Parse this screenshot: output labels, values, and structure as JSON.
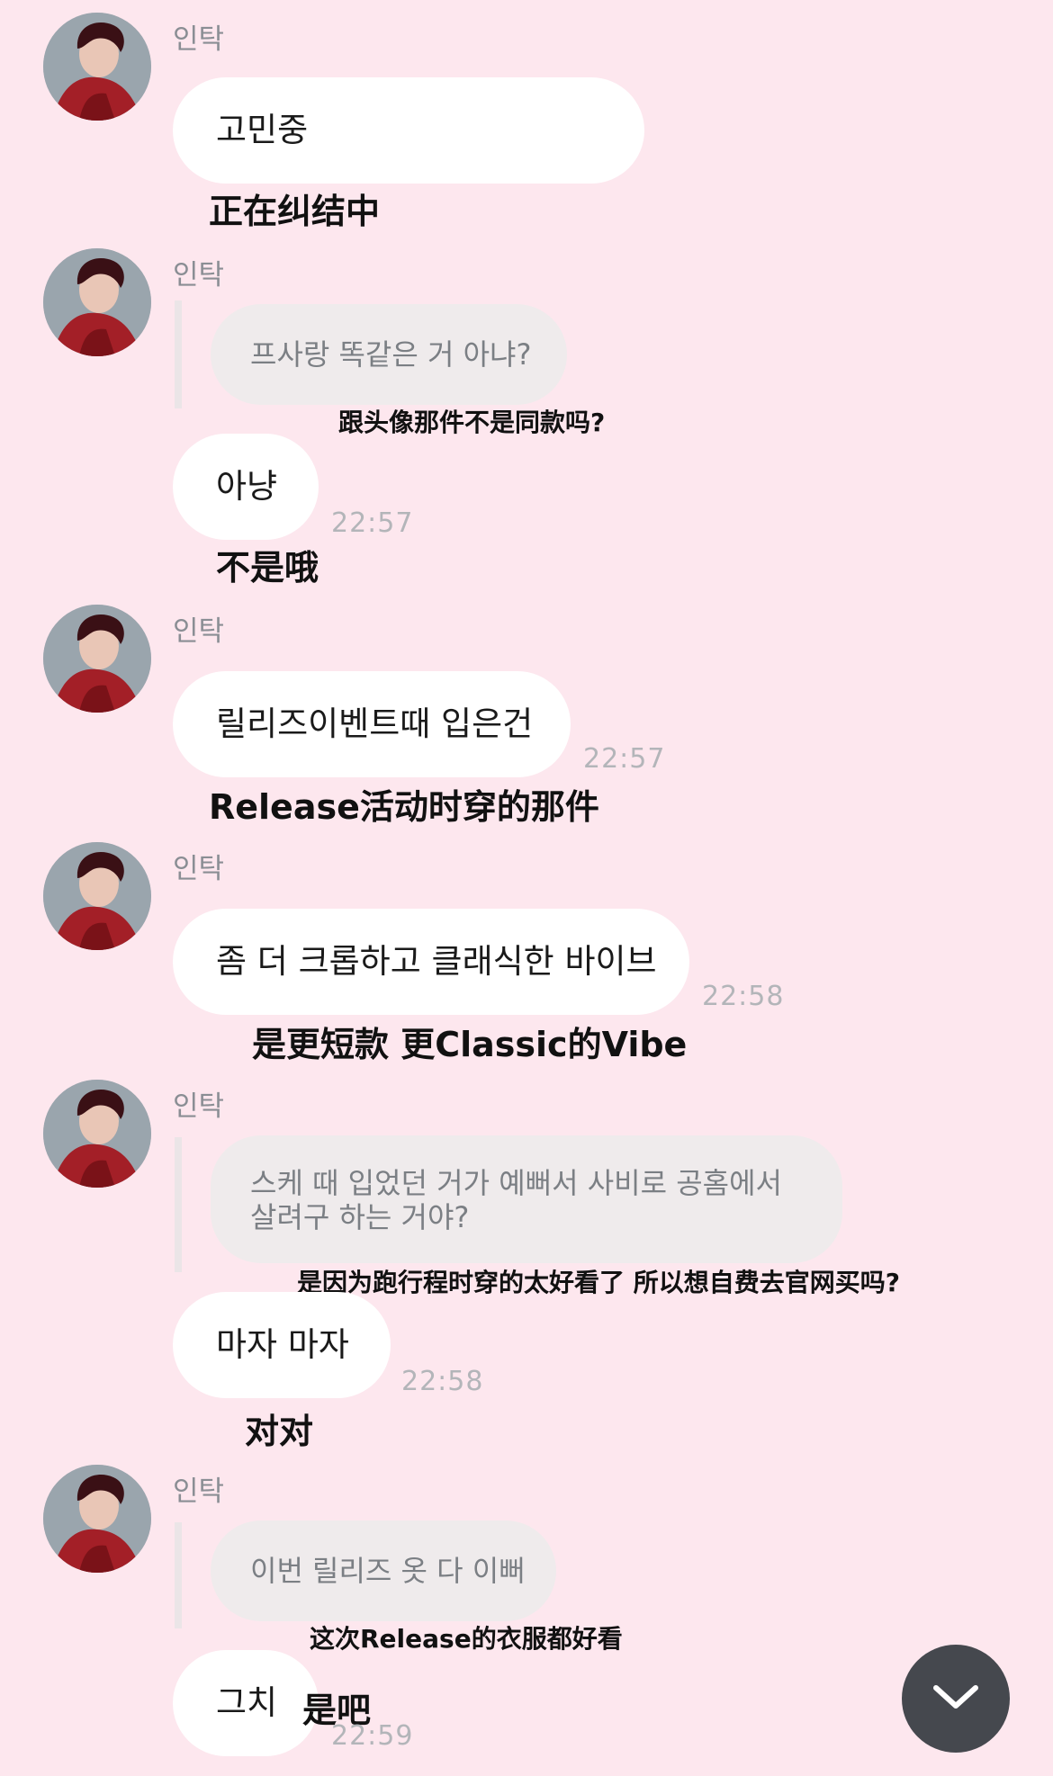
{
  "sender_name": "인탁",
  "scroll_button": {
    "icon": "chevron-down-icon"
  },
  "messages": [
    {
      "text": "고민중",
      "translation": "正在纠结中"
    },
    {
      "quote": "프사랑 똑같은 거 아냐?",
      "quote_translation": "跟头像那件不是同款吗?",
      "text": "아냥",
      "time": "22:57",
      "translation": "不是哦"
    },
    {
      "text": "릴리즈이벤트때 입은건",
      "time": "22:57",
      "translation": "Release活动时穿的那件"
    },
    {
      "text": "좀 더 크롭하고 클래식한 바이브",
      "time": "22:58",
      "translation": "是更短款 更Classic的Vibe"
    },
    {
      "quote": "스케 때 입었던 거가 예뻐서 사비로 공홈에서 살려구 하는 거야?",
      "quote_translation": "是因为跑行程时穿的太好看了 所以想自费去官网买吗?",
      "text": "마자 마자",
      "time": "22:58",
      "translation": "对对"
    },
    {
      "quote": "이번 릴리즈 옷 다 이뻐",
      "quote_translation": "这次Release的衣服都好看",
      "text": "그치",
      "time": "22:59",
      "translation": "是吧"
    }
  ]
}
